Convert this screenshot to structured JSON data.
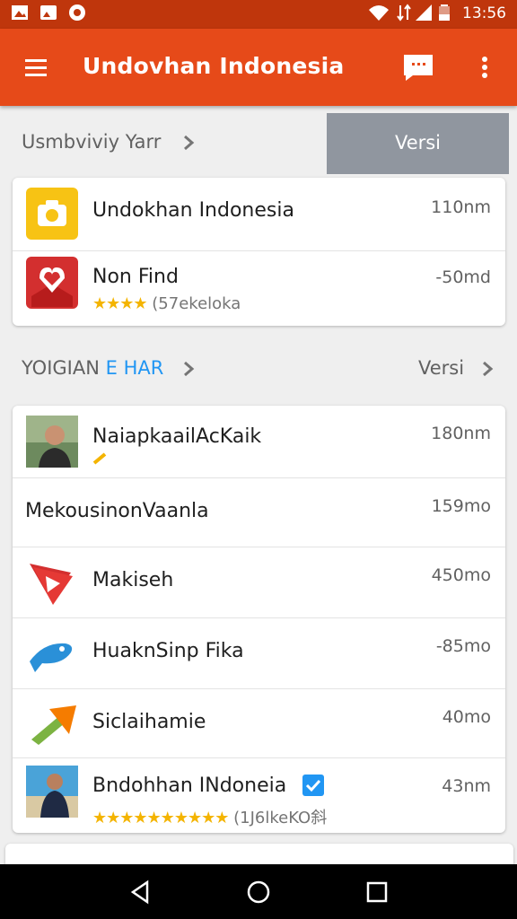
{
  "status_bar": {
    "time": "13:56"
  },
  "app_bar": {
    "title": "Undovhan Indonesia"
  },
  "section1": {
    "title": "Usmbviviy Yarr",
    "button": "Versi"
  },
  "card1": [
    {
      "name": "Undokhan Indonesia",
      "size": "110nm",
      "icon": "camera-icon"
    },
    {
      "name": "Non Find",
      "size": "-50md",
      "rating_stars": "★★★★",
      "rating_text": "(57ekeloka",
      "icon": "heart-map-icon"
    }
  ],
  "section2": {
    "title_a": "YOIGIAN ",
    "title_b": "E HAR",
    "link": "Versi"
  },
  "card2": [
    {
      "name": "NaiapkaailAcKaik",
      "size": "180nm",
      "icon": "person-photo-icon"
    },
    {
      "name": "MekousinonVaanla",
      "size": "159mo"
    },
    {
      "name": "Makiseh",
      "size": "450mo",
      "icon": "play-icon"
    },
    {
      "name": "HuaknSinp Fika",
      "size": "-85mo",
      "icon": "fish-icon"
    },
    {
      "name": "Siclaihamie",
      "size": "40mo",
      "icon": "arrow-icon"
    },
    {
      "name": "Bndohhan INdoneia",
      "size": "43nm",
      "rating_stars": "★★★★★★★★★★",
      "rating_text": "(1J6lkeKO斜",
      "icon": "person-photo-icon"
    }
  ],
  "colors": {
    "status": "#bf360c",
    "appbar": "#e64a19",
    "accent": "#2196f3"
  }
}
